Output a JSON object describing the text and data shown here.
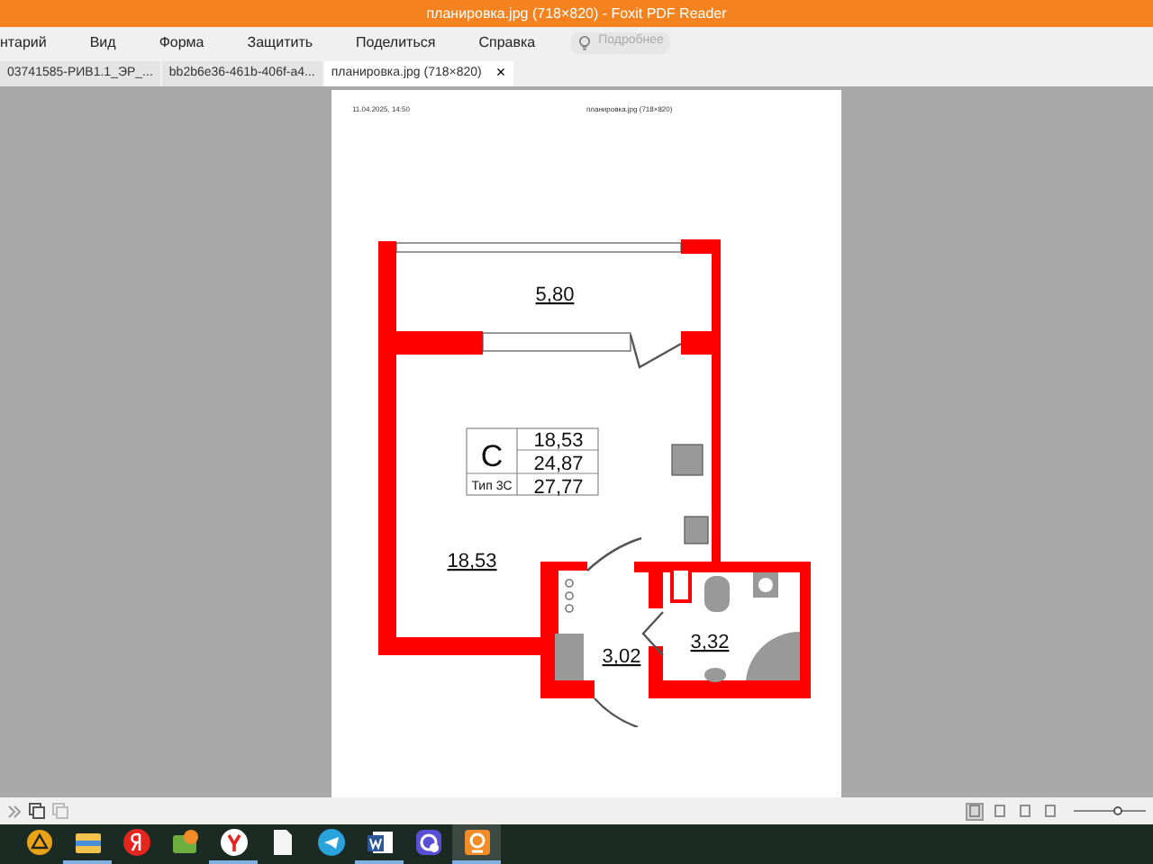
{
  "window": {
    "title": "планировка.jpg (718×820) - Foxit PDF Reader"
  },
  "menu": [
    "нтарий",
    "Вид",
    "Форма",
    "Защитить",
    "Поделиться",
    "Справка"
  ],
  "search": {
    "placeholder": "Подробнее"
  },
  "tabs": [
    {
      "label": "03741585-РИВ1.1_ЭР_...",
      "selected": false,
      "closable": false
    },
    {
      "label": "bb2b6e36-461b-406f-a4...",
      "selected": false,
      "closable": false
    },
    {
      "label": "планировка.jpg (718×820)",
      "selected": true,
      "closable": true
    }
  ],
  "close_glyph": "×",
  "page": {
    "header_left": "11.04.2025, 14:50",
    "header_center": "планировка.jpg (718×820)",
    "plan": {
      "type_letter": "С",
      "type_name": "Тип 3С",
      "areas": [
        "18,53",
        "24,87",
        "27,77"
      ],
      "rooms": [
        {
          "kind": "balcony",
          "area": "5,80"
        },
        {
          "kind": "room",
          "area": "18,53"
        },
        {
          "kind": "hall",
          "area": "3,02"
        },
        {
          "kind": "bath",
          "area": "3,32"
        }
      ]
    }
  },
  "status_bar": {
    "view_modes": [
      {
        "selected": true
      },
      {
        "selected": false
      },
      {
        "selected": false
      },
      {
        "selected": false
      }
    ],
    "zoom": {
      "level": 0.6
    }
  },
  "taskbar": {
    "apps": [
      {
        "kind": "warning",
        "active": false
      },
      {
        "kind": "folder",
        "active": true
      },
      {
        "kind": "ya",
        "active": false
      },
      {
        "kind": "wallet",
        "active": false
      },
      {
        "kind": "browser",
        "active": true
      },
      {
        "kind": "file",
        "active": false
      },
      {
        "kind": "telegram",
        "active": false
      },
      {
        "kind": "word",
        "active": true
      },
      {
        "kind": "phone",
        "active": false
      },
      {
        "kind": "foxit",
        "active": true
      }
    ]
  }
}
